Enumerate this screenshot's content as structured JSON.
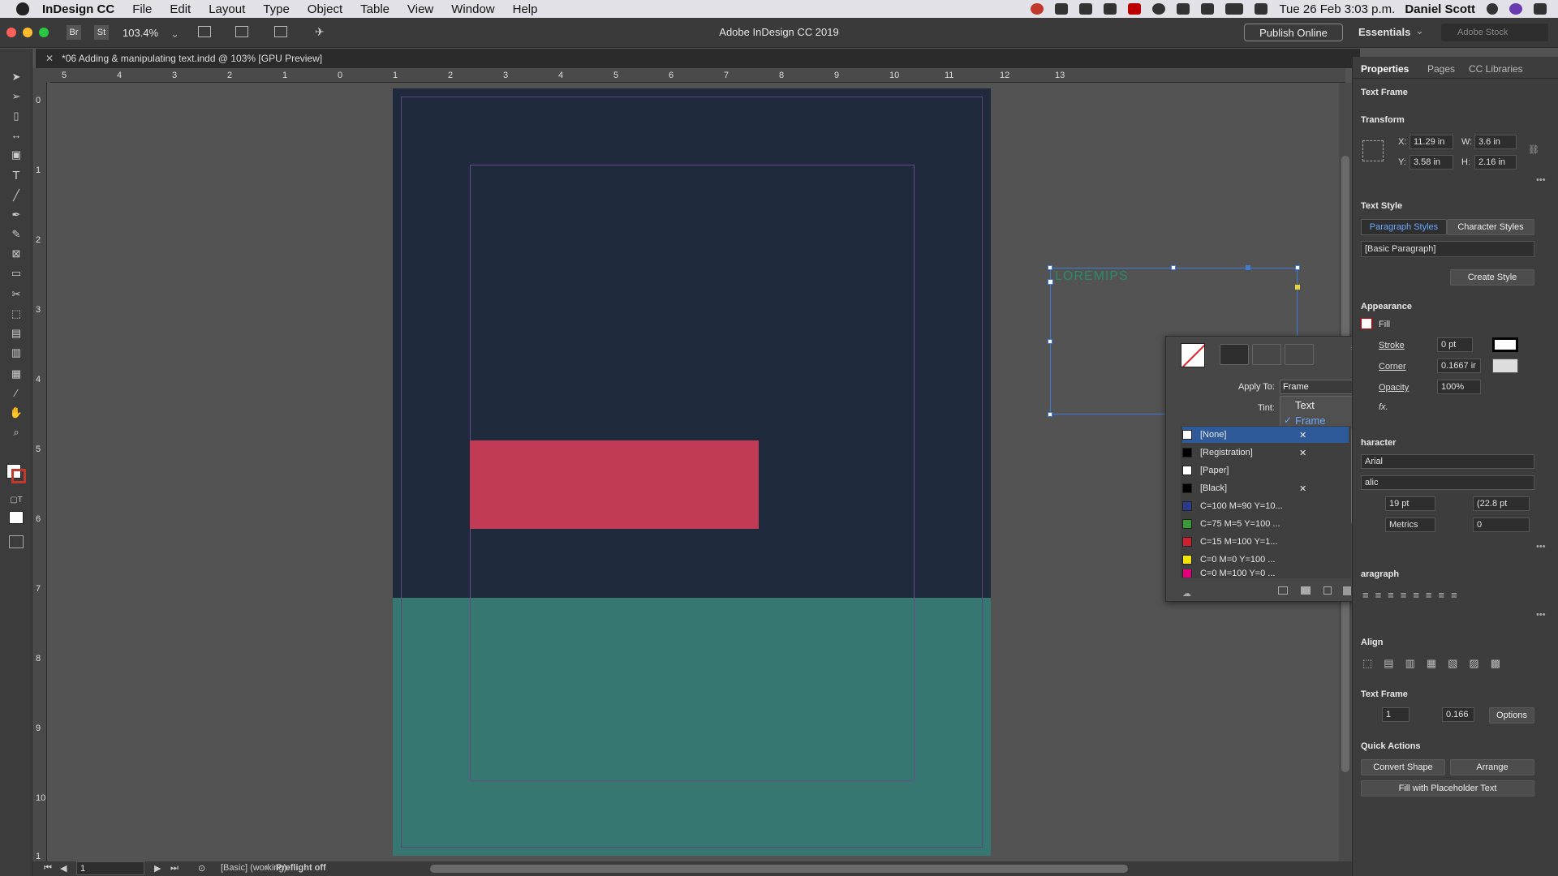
{
  "menubar": {
    "app": "InDesign CC",
    "items": [
      "File",
      "Edit",
      "Layout",
      "Type",
      "Object",
      "Table",
      "View",
      "Window",
      "Help"
    ],
    "clock": "Tue 26 Feb  3:03 p.m.",
    "user": "Daniel Scott"
  },
  "appbar": {
    "zoom": "103.4%",
    "title": "Adobe InDesign CC 2019",
    "publish": "Publish Online",
    "workspace": "Essentials",
    "search_placeholder": "Adobe Stock",
    "br": "Br",
    "st": "St"
  },
  "doc_tab": "*06 Adding & manipulating text.indd @ 103% [GPU Preview]",
  "ruler": {
    "h": [
      "5",
      "4",
      "3",
      "2",
      "1",
      "0",
      "1",
      "2",
      "3",
      "4",
      "5",
      "6",
      "7",
      "8",
      "9",
      "10",
      "11",
      "12",
      "13"
    ],
    "v": [
      "0",
      "1",
      "2",
      "3",
      "4",
      "5",
      "6",
      "7",
      "8",
      "9",
      "10",
      "1"
    ]
  },
  "placeholder_text": "LOREMIPS",
  "swatch_panel": {
    "apply_to_label": "Apply To:",
    "apply_to_value": "Frame",
    "tint_label": "Tint:",
    "options": [
      "Text",
      "Frame"
    ],
    "swatches": [
      {
        "name": "[None]",
        "color": "#ffffff"
      },
      {
        "name": "[Registration]",
        "color": "#000000"
      },
      {
        "name": "[Paper]",
        "color": "#ffffff"
      },
      {
        "name": "[Black]",
        "color": "#000000"
      },
      {
        "name": "C=100 M=90 Y=10...",
        "color": "#2a3a8c"
      },
      {
        "name": "C=75 M=5 Y=100 ...",
        "color": "#3a9a3a"
      },
      {
        "name": "C=15 M=100 Y=1...",
        "color": "#cc1f2f"
      },
      {
        "name": "C=0 M=0 Y=100 ...",
        "color": "#f2e600"
      },
      {
        "name": "C=0 M=100 Y=0 ...",
        "color": "#e0007a"
      }
    ]
  },
  "panel": {
    "tabs": [
      "Properties",
      "Pages",
      "CC Libraries"
    ],
    "object": "Text Frame",
    "transform": "Transform",
    "x": "11.29 in",
    "w": "3.6 in",
    "y": "3.58 in",
    "h": "2.16 in",
    "x_label": "X:",
    "y_label": "Y:",
    "w_label": "W:",
    "h_label": "H:",
    "text_style": "Text Style",
    "para_styles": "Paragraph Styles",
    "char_styles": "Character Styles",
    "basic_para": "[Basic Paragraph]",
    "create_style": "Create Style",
    "appearance": "Appearance",
    "fill": "Fill",
    "stroke": "Stroke",
    "stroke_val": "0 pt",
    "corner": "Corner",
    "corner_val": "0.1667 ir",
    "opacity": "Opacity",
    "opacity_val": "100%",
    "fx": "fx.",
    "character": "haracter",
    "font": "Arial",
    "style": "alic",
    "size": "19 pt",
    "leading": "(22.8 pt",
    "kerning": "Metrics",
    "tracking": "0",
    "paragraph": "aragraph",
    "align": "Align",
    "text_frame": "Text Frame",
    "cols": "1",
    "gutter": "0.166",
    "options": "Options",
    "quick_actions": "Quick Actions",
    "convert_shape": "Convert Shape",
    "arrange": "Arrange",
    "fill_placeholder": "Fill with Placeholder Text"
  },
  "status": {
    "page": "1",
    "style": "[Basic] (working)",
    "preflight": "Preflight off"
  }
}
